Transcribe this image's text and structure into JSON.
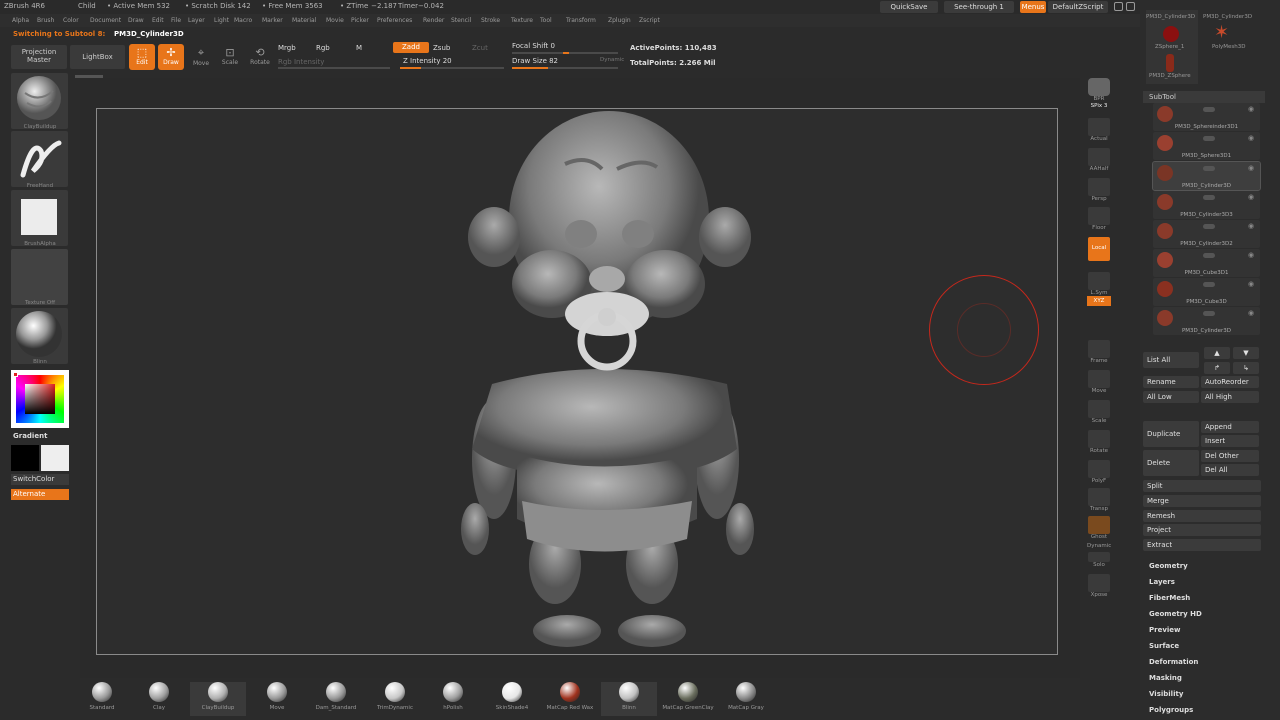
{
  "titlebar": {
    "app": "ZBrush 4R6",
    "doc": "Child",
    "active_mem": "• Active Mem 532",
    "scratch": "• Scratch Disk 142",
    "free_mem": "• Free Mem 3563",
    "ztime": "• ZTime  −2.187",
    "timer": "Timer−0.042",
    "quicksave": "QuickSave",
    "seethrough": "See-through   1",
    "menus": "Menus",
    "defaultzscript": "DefaultZScript"
  },
  "menus": [
    "Alpha",
    "Brush",
    "Color",
    "Document",
    "Draw",
    "Edit",
    "File",
    "Layer",
    "Light",
    "Macro",
    "Marker",
    "Material",
    "Movie",
    "Picker",
    "Preferences",
    "Render",
    "Stencil",
    "Stroke",
    "Texture",
    "Tool",
    "Transform",
    "Zplugin",
    "Zscript"
  ],
  "toolbar": {
    "switching_prefix": "Switching to Subtool 8:",
    "switching_name": "PM3D_Cylinder3D",
    "projection_master": "Projection Master",
    "lightbox": "LightBox",
    "edit": "Edit",
    "draw": "Draw",
    "move": "Move",
    "scale": "Scale",
    "rotate": "Rotate",
    "mrgb": "Mrgb",
    "rgb": "Rgb",
    "m": "M",
    "zadd": "Zadd",
    "zsub": "Zsub",
    "zcut": "Zcut",
    "rgb_intensity": "Rgb  Intensity",
    "z_intensity": "Z Intensity 20",
    "focal_shift": "Focal Shift 0",
    "draw_size": "Draw Size 82",
    "dynamic": "Dynamic",
    "active_points": "ActivePoints: 110,483",
    "total_points": "TotalPoints: 2.266 Mil"
  },
  "left": {
    "brush": "ClayBuildup",
    "stroke": "FreeHand",
    "alpha": "BrushAlpha",
    "texture": "Texture Off",
    "material": "Blinn",
    "gradient": "Gradient",
    "switchcolor": "SwitchColor",
    "alternate": "Alternate"
  },
  "right_shelf": [
    "BPR",
    "SPix 3",
    "Actual",
    "AAHalf",
    "Persp",
    "Floor",
    "Local",
    "L.Sym",
    "XYZ",
    "Frame",
    "Move",
    "Scale",
    "Rotate",
    "PolyF",
    "Transp",
    "Ghost",
    "Dynamic",
    "Solo",
    "Xpose"
  ],
  "tool_palette": {
    "thumbs": [
      "PM3D_Cylinder3D",
      "PM3D_Cylinder3D",
      "ZSphere_1",
      "PolyMesh3D",
      "PM3D_ZSphere"
    ],
    "subtool_header": "SubTool",
    "subtools": [
      "PM3D_Sphereinder3D1",
      "PM3D_Sphere3D1",
      "PM3D_Cylinder3D",
      "PM3D_Cylinder3D3",
      "PM3D_Cylinder3D2",
      "PM3D_Cube3D1",
      "PM3D_Cube3D",
      "PM3D_Cylinder3D"
    ],
    "list_all": "List All",
    "rename": "Rename",
    "autoreorder": "AutoReorder",
    "all_low": "All Low",
    "all_high": "All High",
    "duplicate": "Duplicate",
    "append": "Append",
    "insert": "Insert",
    "delete": "Delete",
    "del_other": "Del Other",
    "del_all": "Del All",
    "split": "Split",
    "merge": "Merge",
    "remesh": "Remesh",
    "project": "Project",
    "extract": "Extract",
    "sections": [
      "Geometry",
      "Layers",
      "FiberMesh",
      "Geometry HD",
      "Preview",
      "Surface",
      "Deformation",
      "Masking",
      "Visibility",
      "Polygroups"
    ]
  },
  "brushes": [
    {
      "name": "Standard",
      "color": "#9a9a9a"
    },
    {
      "name": "Clay",
      "color": "#a0a0a0"
    },
    {
      "name": "ClayBuildup",
      "color": "#b0b0b0"
    },
    {
      "name": "Move",
      "color": "#9a9a9a"
    },
    {
      "name": "Dam_Standard",
      "color": "#9a9a9a"
    },
    {
      "name": "TrimDynamic",
      "color": "#c8c8c8"
    },
    {
      "name": "hPolish",
      "color": "#a0a0a0"
    },
    {
      "name": "SkinShade4",
      "color": "#e6e6e6"
    },
    {
      "name": "MatCap Red Wax",
      "color": "#a0321e"
    },
    {
      "name": "Blinn",
      "color": "#c0c0c0"
    },
    {
      "name": "MatCap GreenClay",
      "color": "#6a6e5e"
    },
    {
      "name": "MatCap Gray",
      "color": "#8a8a8a"
    }
  ],
  "colors": {
    "accent": "#e8751a",
    "bg": "#2b2b2b",
    "cursor": "#c4281c"
  }
}
